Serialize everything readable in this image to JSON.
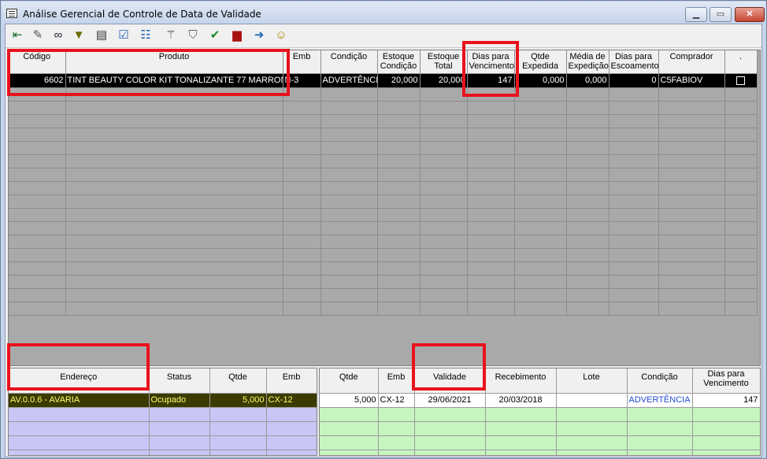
{
  "window": {
    "title": "Análise Gerencial de Controle de Data de Validade",
    "buttons": {
      "minimize": "▁",
      "maximize": "▭",
      "close": "✕"
    }
  },
  "toolbar": {
    "icons": [
      "exit-icon",
      "edit-pencil-icon",
      "binoculars-icon",
      "filter-icon",
      "printer-icon",
      "checklist-icon",
      "tree-list-icon",
      "magic-wand-icon",
      "shield-icon",
      "shield-check-icon",
      "truck-icon",
      "export-icon",
      "user-report-icon"
    ]
  },
  "colors": {
    "selected_row_bg": "#000000",
    "warning_text": "#ffff00",
    "left_panel_bg": "#c8c6f5",
    "right_panel_bg": "#c6f5c0",
    "highlight": "#e8121d",
    "condition_blue": "#1f4bd3"
  },
  "top_grid": {
    "headers": {
      "codigo": "Código",
      "produto": "Produto",
      "emb": "Emb",
      "condicao": "Condição",
      "estoque_condicao": "Estoque Condição",
      "estoque_total": "Estoque Total",
      "dias_vencimento": "Dias para Vencimento",
      "qtde_expedida": "Qtde Expedida",
      "media_expedicao": "Média de Expedição",
      "dias_escoamento": "Dias para Escoamento",
      "comprador": "Comprador",
      "flag": "."
    },
    "rows": [
      {
        "codigo": "6602",
        "produto": "TINT BEAUTY COLOR KIT TONALIZANTE 77 MARRON",
        "emb": "N-3",
        "condicao": "ADVERTÊNCIA",
        "estoque_condicao": "20,000",
        "estoque_total": "20,000",
        "dias_vencimento": "147",
        "qtde_expedida": "0,000",
        "media_expedicao": "0,000",
        "dias_escoamento": "0",
        "comprador": "C5FABIOV"
      }
    ]
  },
  "bottom_left": {
    "headers": {
      "endereco": "Endereço",
      "status": "Status",
      "qtde": "Qtde",
      "emb": "Emb"
    },
    "rows": [
      {
        "endereco": "AV.0.0.6 - AVARIA",
        "status": "Ocupado",
        "qtde": "5,000",
        "emb": "CX-12"
      }
    ]
  },
  "bottom_right": {
    "headers": {
      "qtde": "Qtde",
      "emb": "Emb",
      "validade": "Validade",
      "recebimento": "Recebimento",
      "lote": "Lote",
      "condicao": "Condição",
      "dias_vencimento": "Dias para Vencimento"
    },
    "rows": [
      {
        "qtde": "5,000",
        "emb": "CX-12",
        "validade": "29/06/2021",
        "recebimento": "20/03/2018",
        "lote": "",
        "condicao": "ADVERTÊNCIA",
        "dias_vencimento": "147"
      }
    ]
  }
}
